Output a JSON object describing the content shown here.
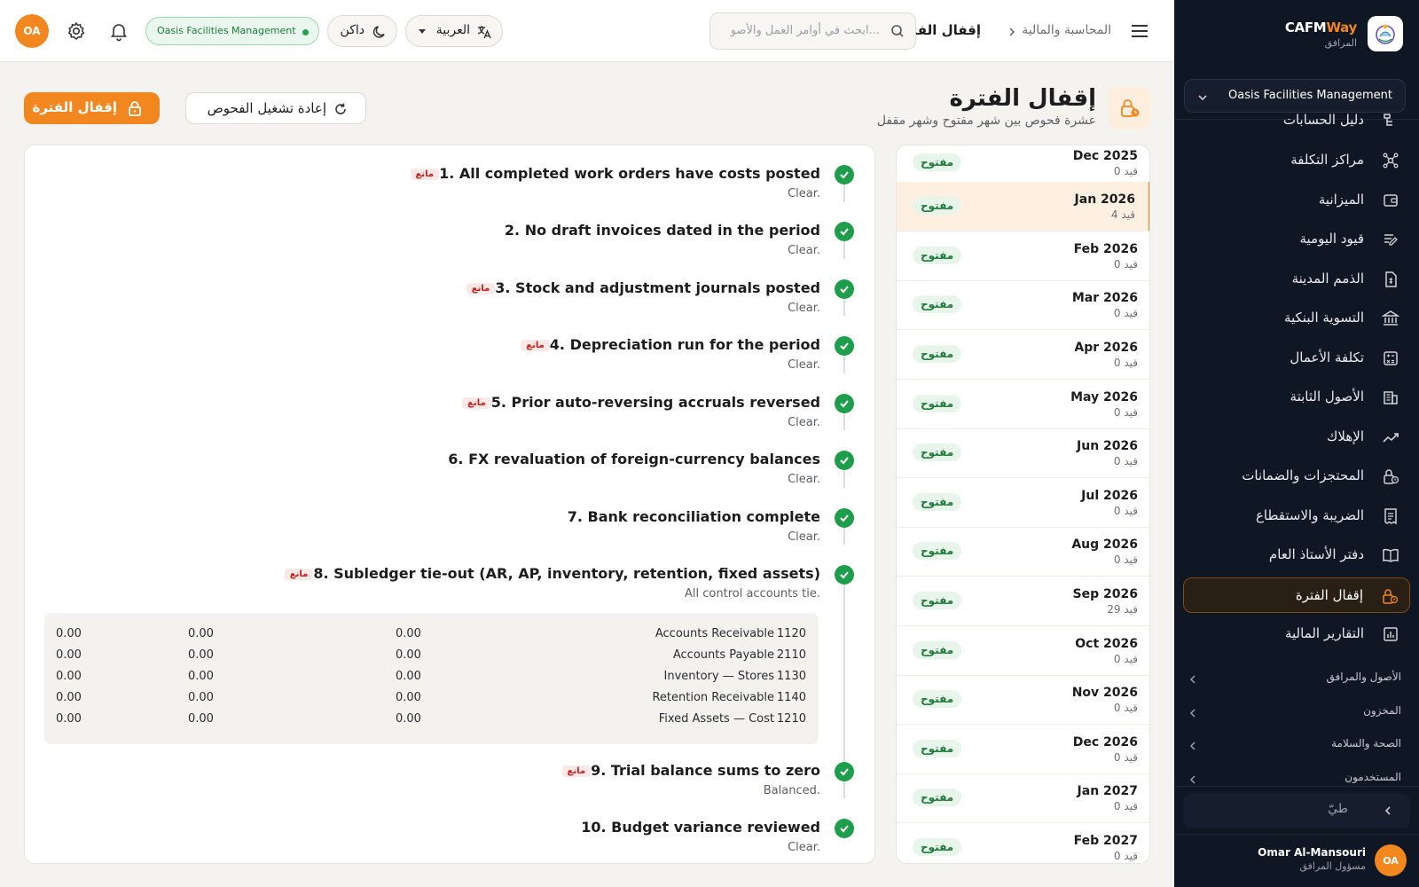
{
  "brand": {
    "name_part1": "CAFM",
    "name_part2": "Way",
    "subtitle": "المرافق"
  },
  "sidebar": {
    "org_selector": "Oasis Facilities Management",
    "items": [
      {
        "label": "دليل الحسابات",
        "icon": "chart-of-accounts-icon"
      },
      {
        "label": "مراكز التكلفة",
        "icon": "network-icon"
      },
      {
        "label": "الميزانية",
        "icon": "wallet-icon"
      },
      {
        "label": "قيود اليومية",
        "icon": "journal-edit-icon"
      },
      {
        "label": "الذمم المدينة",
        "icon": "receivable-document-icon"
      },
      {
        "label": "التسوية البنكية",
        "icon": "bank-icon"
      },
      {
        "label": "تكلفة الأعمال",
        "icon": "calculator-icon"
      },
      {
        "label": "الأصول الثابتة",
        "icon": "building-icon"
      },
      {
        "label": "الإهلاك",
        "icon": "trend-icon"
      },
      {
        "label": "المحتجزات والضمانات",
        "icon": "lock-clock-icon"
      },
      {
        "label": "الضريبة والاستقطاع",
        "icon": "receipt-icon"
      },
      {
        "label": "دفتر الأستاذ العام",
        "icon": "book-open-icon"
      },
      {
        "label": "إقفال الفترة",
        "icon": "lock-clock-icon",
        "active": true
      },
      {
        "label": "التقارير المالية",
        "icon": "report-chart-icon"
      }
    ],
    "groups": [
      "الأصول والمرافق",
      "المخزون",
      "الصحة والسلامة",
      "المستخدمون"
    ],
    "collapse_label": "طيّ",
    "user": {
      "name": "Omar Al-Mansouri",
      "role": "مسؤول المرافق",
      "initials": "OA"
    }
  },
  "topbar": {
    "breadcrumb_parent": "المحاسبة والمالية",
    "breadcrumb_current": "إقفال الفترة",
    "search_placeholder": "ابحث في أوامر العمل والأصو...",
    "language": "العربية",
    "theme": "داكن",
    "org_badge": "Oasis Facilities Management",
    "avatar_initials": "OA"
  },
  "page": {
    "title": "إقفال الفترة",
    "subtitle": "عشرة فحوص بين شهر مفتوح وشهر مقفل",
    "rerun_label": "إعادة تشغيل الفحوص",
    "close_label": "إقفال الفترة"
  },
  "periods": [
    {
      "name": "Dec 2025",
      "count": "0 قيد",
      "status": "مفتوح"
    },
    {
      "name": "Jan 2026",
      "count": "4 قيد",
      "status": "مفتوح",
      "selected": true
    },
    {
      "name": "Feb 2026",
      "count": "0 قيد",
      "status": "مفتوح"
    },
    {
      "name": "Mar 2026",
      "count": "0 قيد",
      "status": "مفتوح"
    },
    {
      "name": "Apr 2026",
      "count": "0 قيد",
      "status": "مفتوح"
    },
    {
      "name": "May 2026",
      "count": "0 قيد",
      "status": "مفتوح"
    },
    {
      "name": "Jun 2026",
      "count": "0 قيد",
      "status": "مفتوح"
    },
    {
      "name": "Jul 2026",
      "count": "0 قيد",
      "status": "مفتوح"
    },
    {
      "name": "Aug 2026",
      "count": "0 قيد",
      "status": "مفتوح"
    },
    {
      "name": "Sep 2026",
      "count": "29 قيد",
      "status": "مفتوح"
    },
    {
      "name": "Oct 2026",
      "count": "0 قيد",
      "status": "مفتوح"
    },
    {
      "name": "Nov 2026",
      "count": "0 قيد",
      "status": "مفتوح"
    },
    {
      "name": "Dec 2026",
      "count": "0 قيد",
      "status": "مفتوح"
    },
    {
      "name": "Jan 2027",
      "count": "0 قيد",
      "status": "مفتوح"
    },
    {
      "name": "Feb 2027",
      "count": "0 قيد",
      "status": "مفتوح"
    }
  ],
  "checks": [
    {
      "title": "1. All completed work orders have costs posted",
      "blocking": "مانع",
      "detail": "Clear."
    },
    {
      "title": "2. No draft invoices dated in the period",
      "blocking": "",
      "detail": "Clear."
    },
    {
      "title": "3. Stock and adjustment journals posted",
      "blocking": "مانع",
      "detail": "Clear."
    },
    {
      "title": "4. Depreciation run for the period",
      "blocking": "مانع",
      "detail": "Clear."
    },
    {
      "title": "5. Prior auto-reversing accruals reversed",
      "blocking": "مانع",
      "detail": "Clear."
    },
    {
      "title": "6. FX revaluation of foreign-currency balances",
      "blocking": "",
      "detail": "Clear."
    },
    {
      "title": "7. Bank reconciliation complete",
      "blocking": "",
      "detail": "Clear."
    },
    {
      "title": "8. Subledger tie-out (AR, AP, inventory, retention, fixed assets)",
      "blocking": "مانع",
      "detail": "All control accounts tie."
    },
    {
      "title": "9. Trial balance sums to zero",
      "blocking": "مانع",
      "detail": "Balanced."
    },
    {
      "title": "10. Budget variance reviewed",
      "blocking": "",
      "detail": "Clear."
    }
  ],
  "tieout": [
    {
      "code": "1120",
      "account": "Accounts Receivable",
      "v1": "0.00",
      "v2": "0.00",
      "v3": "0.00"
    },
    {
      "code": "2110",
      "account": "Accounts Payable",
      "v1": "0.00",
      "v2": "0.00",
      "v3": "0.00"
    },
    {
      "code": "1130",
      "account": "Inventory — Stores",
      "v1": "0.00",
      "v2": "0.00",
      "v3": "0.00"
    },
    {
      "code": "1140",
      "account": "Retention Receivable",
      "v1": "0.00",
      "v2": "0.00",
      "v3": "0.00"
    },
    {
      "code": "1210",
      "account": "Fixed Assets — Cost",
      "v1": "0.00",
      "v2": "0.00",
      "v3": "0.00"
    }
  ],
  "colors": {
    "accent": "#f2871f",
    "sidebar_bg": "#0f1624",
    "success": "#1e9e4a",
    "blocking": "#c81e1e"
  }
}
